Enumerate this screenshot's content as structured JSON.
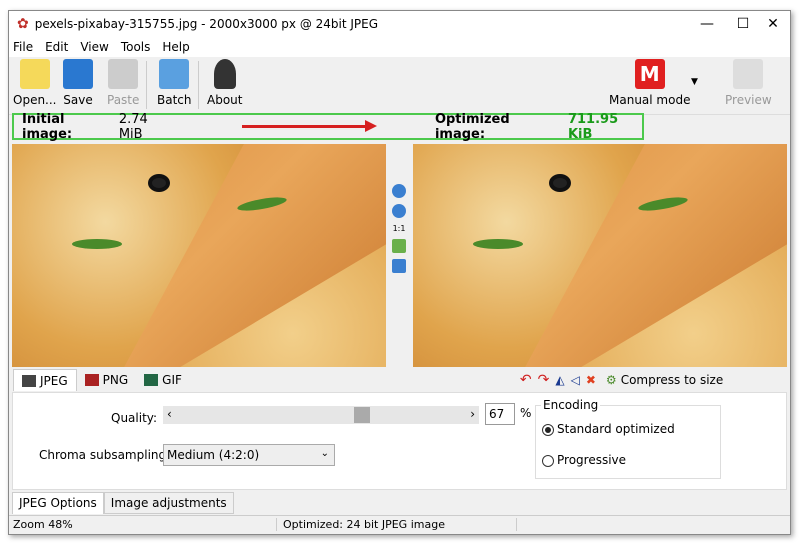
{
  "window": {
    "title": "pexels-pixabay-315755.jpg - 2000x3000 px @ 24bit JPEG",
    "minimize": "—",
    "maximize": "☐",
    "close": "✕"
  },
  "menu": [
    "File",
    "Edit",
    "View",
    "Tools",
    "Help"
  ],
  "toolbar": {
    "open": "Open...",
    "save": "Save",
    "paste": "Paste",
    "batch": "Batch",
    "about": "About",
    "mode": "Manual mode",
    "mode_letter": "M",
    "preview": "Preview"
  },
  "info": {
    "initial_label": "Initial image:",
    "initial_value": "2.74 MiB",
    "optimized_label": "Optimized image:",
    "optimized_value": "711.95 KiB",
    "optimized_color": "#1a9a1a"
  },
  "viewer": {
    "one_to_one": "1:1"
  },
  "formats": [
    "JPEG",
    "PNG",
    "GIF"
  ],
  "compress": "Compress to size",
  "options": {
    "quality_label": "Quality:",
    "quality_value": "67",
    "quality_unit": "%",
    "quality_percent": 67,
    "chroma_label": "Chroma subsampling:",
    "chroma_value": "Medium (4:2:0)",
    "encoding_title": "Encoding",
    "enc_standard": "Standard optimized",
    "enc_progressive": "Progressive"
  },
  "bottom_tabs": [
    "JPEG Options",
    "Image adjustments"
  ],
  "status": {
    "zoom": "Zoom 48%",
    "info": "Optimized: 24 bit JPEG image"
  }
}
